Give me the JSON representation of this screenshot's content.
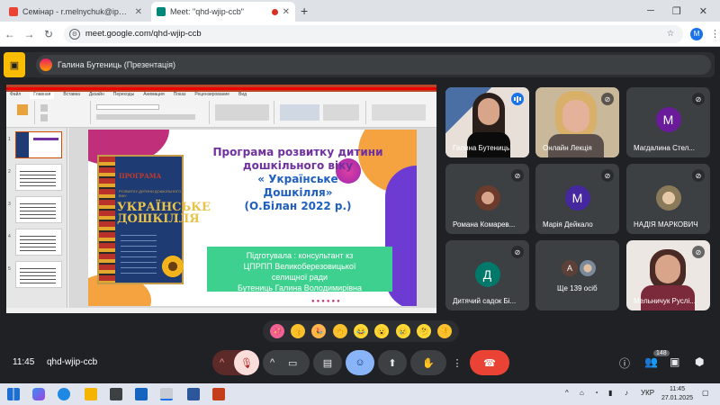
{
  "browser": {
    "tabs": [
      {
        "title": "Семінар - r.melnychuk@ippo.ed",
        "active": false
      },
      {
        "title": "Meet: \"qhd-wjip-ccb\"",
        "active": true
      }
    ],
    "new_tab_symbol": "+",
    "url": "meet.google.com/qhd-wjip-ccb",
    "profile_initial": "M",
    "window_controls": {
      "minimize": "─",
      "restore": "❐",
      "close": "✕"
    }
  },
  "presentation_bar": {
    "label": "Галина Бутениць (Презентація)"
  },
  "shared_screen": {
    "app_title": "Презентація PowerPoint — Мій файл",
    "ribbon_tabs": [
      "Файл",
      "Главная",
      "Вставка",
      "Дизайн",
      "Переходы",
      "Анимация",
      "Показ",
      "Рецензирование",
      "Вид"
    ],
    "slide": {
      "title_line1": "Програма розвитку дитини",
      "title_line2": "дошкільного віку",
      "title_line3": "« Українське",
      "title_line4": "Дошкілля»",
      "title_line5": "(О.Білан  2022 р.)",
      "box_line1": "Підготувала :  консультант  кз",
      "box_line2": "ЦПРПП Великоберезовицької",
      "box_line3": "селищної  ради",
      "box_line4": "Бутениць Галина  Володимирівна",
      "book_small_title": "ПРОГРАМА",
      "book_subtitle": "РОЗВИТКУ ДИТИНИ ДОШКІЛЬНОГО ВІКУ",
      "book_big_title": "УКРАЇНСЬКЕ ДОШКІЛЛЯ"
    },
    "statusbar": "Слайд 1 из 15"
  },
  "participants": [
    {
      "name": "Галина Бутениць",
      "type": "photo",
      "speaking": true
    },
    {
      "name": "Онлайн Лекція",
      "type": "photo",
      "muted": true
    },
    {
      "name": "Магдалина Стел...",
      "type": "avatar",
      "initial": "M",
      "color": "#6a1b9a",
      "muted": true
    },
    {
      "name": "Романа Комарев...",
      "type": "smallphoto",
      "muted": true
    },
    {
      "name": "Марія Дейкало",
      "type": "avatar",
      "initial": "M",
      "color": "#4527a0",
      "muted": true
    },
    {
      "name": "НАДІЯ МАРКОВИЧ",
      "type": "smallphoto",
      "muted": true
    },
    {
      "name": "Дитячий садок Бі...",
      "type": "avatar",
      "initial": "Д",
      "color": "#00796b",
      "muted": true
    },
    {
      "name": "Ще 139 осіб",
      "type": "more",
      "initial": "А"
    },
    {
      "name": "Мельничук Руслі...",
      "type": "photo",
      "muted": true
    }
  ],
  "reactions": [
    "💖",
    "👍",
    "🎉",
    "👏",
    "😂",
    "😮",
    "😢",
    "🤔",
    "👎"
  ],
  "meeting": {
    "time": "11:45",
    "code": "qhd-wjip-ccb",
    "participant_count": "148"
  },
  "taskbar": {
    "language": "УКР",
    "time": "11:45",
    "date": "27.01.2025"
  },
  "colors": {
    "meet_bg": "#202124",
    "end_call": "#ea4335",
    "active_control": "#8ab4f8",
    "mic_off": "#f28b82",
    "slide_title": "#7030a0",
    "slide_box": "#3dd08e"
  }
}
